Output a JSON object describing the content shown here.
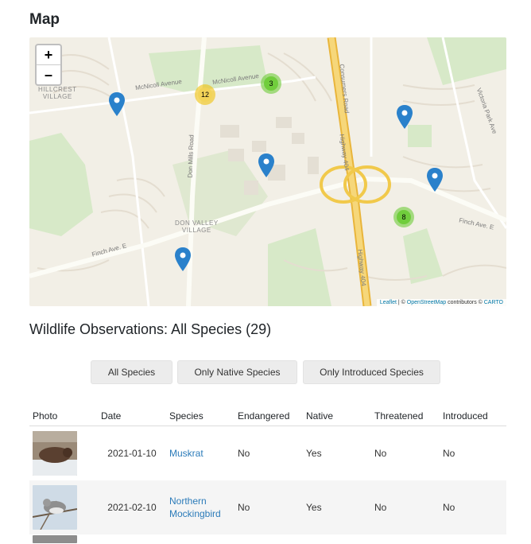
{
  "map_section": {
    "title": "Map",
    "zoom_in": "+",
    "zoom_out": "–",
    "places": [
      {
        "name": "HILLCREST\nVILLAGE"
      },
      {
        "name": "DON VALLEY\nVILLAGE"
      }
    ],
    "streets": [
      {
        "name": "McNicoll Avenue"
      },
      {
        "name": "McNicoll Avenue"
      },
      {
        "name": "Don Mills Road"
      },
      {
        "name": "Consumers Road"
      },
      {
        "name": "Highway 404"
      },
      {
        "name": "Highway 404"
      },
      {
        "name": "Victoria Park Ave"
      },
      {
        "name": "Finch Ave. E"
      },
      {
        "name": "Finch Ave. E"
      }
    ],
    "clusters": [
      {
        "count": "12"
      },
      {
        "count": "3"
      },
      {
        "count": "8"
      }
    ],
    "attribution": {
      "leaflet": "Leaflet",
      "sep1": " | © ",
      "osm": "OpenStreetMap",
      "mid": " contributors © ",
      "carto": "CARTO"
    }
  },
  "observations": {
    "title": "Wildlife Observations: All Species (29)",
    "filters": [
      "All Species",
      "Only Native Species",
      "Only Introduced Species"
    ],
    "columns": [
      "Photo",
      "Date",
      "Species",
      "Endangered",
      "Native",
      "Threatened",
      "Introduced"
    ],
    "rows": [
      {
        "photo_icon": "muskrat-photo",
        "date": "2021-01-10",
        "species": "Muskrat",
        "endangered": "No",
        "native": "Yes",
        "threatened": "No",
        "introduced": "No"
      },
      {
        "photo_icon": "mockingbird-photo",
        "date": "2021-02-10",
        "species": "Northern\nMockingbird",
        "endangered": "No",
        "native": "Yes",
        "threatened": "No",
        "introduced": "No"
      }
    ]
  },
  "colors": {
    "map_bg": "#f2efe6",
    "park": "#d7e9c8",
    "highway": "#f1c94b",
    "pin": "#2a81cb",
    "link": "#2b7bb9"
  }
}
